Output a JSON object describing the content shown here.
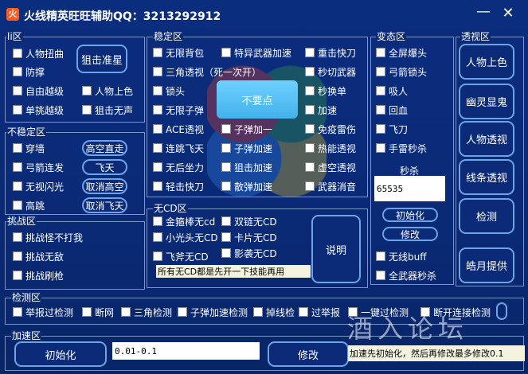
{
  "title": {
    "icon_text": "火",
    "text": "火线精英旺旺辅助QQ：3213292912",
    "minimize": "—",
    "close": "✕"
  },
  "groups": {
    "li": "li区",
    "stable": "稳定区",
    "unstable": "不稳定区",
    "challenge": "挑战区",
    "nocd": "无CD区",
    "transform": "变态区",
    "perspective": "透视区",
    "detect": "检测区",
    "accel": "加速区"
  },
  "li": {
    "items": [
      "人物扭曲",
      "防撑",
      "自由越级",
      "人物上色",
      "单挑越级",
      "狙击无声"
    ],
    "aim_button": "狙击准星"
  },
  "unstable": {
    "items": [
      "穿墙",
      "弓箭连发",
      "无视闪光",
      "高跳"
    ],
    "buttons": [
      "高空直走",
      "飞天",
      "取消高空",
      "取消飞天"
    ]
  },
  "challenge": {
    "items": [
      "挑战怪不打我",
      "挑战无敌",
      "挑战刷枪"
    ]
  },
  "stable": {
    "col1": [
      "无限背包",
      "三角透视（死一次开）",
      "锁头",
      "无限子弹",
      "ACE透视",
      "连跳飞天",
      "无后坐力",
      "轻击快刀"
    ],
    "col2": [
      "特异武器加速",
      "子弹加一",
      "子弹加速",
      "狙击加速",
      "散弹加速"
    ],
    "col3": [
      "重击快刀",
      "秒切武器",
      "秒换单",
      "加速",
      "免疫雷伤",
      "热能透视",
      "虚空透视",
      "武器消音"
    ],
    "center_button": "不要点"
  },
  "nocd": {
    "items": [
      "金箍棒无cd",
      "双链无CD",
      "小光头无CD",
      "卡片无CD",
      "飞斧无CD",
      "影袭无CD"
    ],
    "note": "所有无CD都是先开一下技能再用",
    "explain_button": "说明"
  },
  "transform": {
    "items": [
      "全屏爆头",
      "弓箭锁头",
      "吸人",
      "回血",
      "飞刀",
      "手雷秒杀"
    ],
    "kill_label": "秒杀",
    "kill_value": "65535",
    "init_button": "初始化",
    "modify_button": "修改",
    "bottom_items": [
      "无线buff",
      "全武器秒杀"
    ]
  },
  "perspective": {
    "buttons": [
      "人物上色",
      "幽灵显鬼",
      "人物透视",
      "线条透视",
      "检测",
      "皓月提供"
    ]
  },
  "detect": {
    "items": [
      "举报过检测",
      "断网",
      "三角检测",
      "子弹加速检测",
      "掉线检",
      "过举报",
      "一键过检测",
      "断开连接检测"
    ]
  },
  "accel": {
    "init_button": "初始化",
    "value": "0.01-0.1",
    "modify_button": "修改",
    "hint": "加速先初始化，然后再修改最多修改0.1"
  },
  "watermark": "酒入论坛"
}
